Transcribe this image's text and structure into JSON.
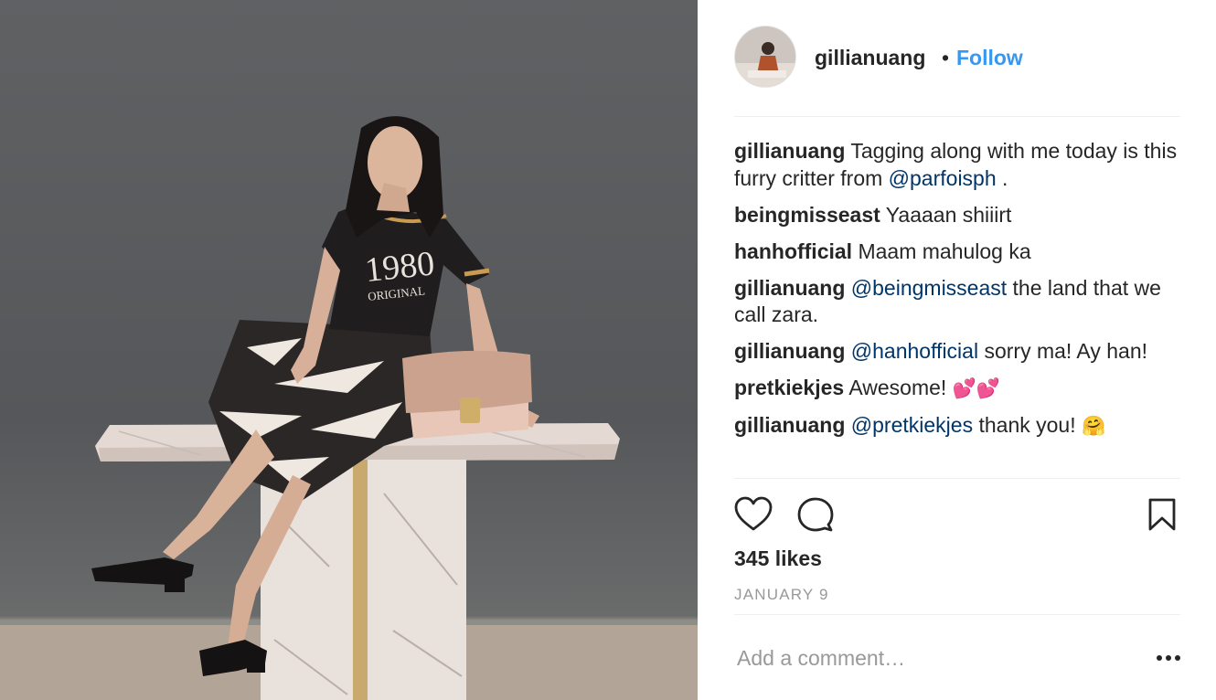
{
  "post": {
    "username": "gillianuang",
    "separator": "•",
    "follow_label": "Follow"
  },
  "comments": [
    {
      "user": "gillianuang",
      "text_before": "Tagging along with me today is this furry critter from ",
      "mention": "@parfoisph",
      "text_after": " ."
    },
    {
      "user": "beingmisseast",
      "text_before": "Yaaaan shiiirt",
      "mention": "",
      "text_after": ""
    },
    {
      "user": "hanhofficial",
      "text_before": "Maam mahulog ka",
      "mention": "",
      "text_after": ""
    },
    {
      "user": "gillianuang",
      "text_before": "",
      "mention": "@beingmisseast",
      "text_after": " the land that we call zara."
    },
    {
      "user": "gillianuang",
      "text_before": "",
      "mention": "@hanhofficial",
      "text_after": " sorry ma! Ay han!"
    },
    {
      "user": "pretkiekjes",
      "text_before": "Awesome! ",
      "mention": "",
      "text_after": "",
      "emoji": "💕💕"
    },
    {
      "user": "gillianuang",
      "text_before": "",
      "mention": "@pretkiekjes",
      "text_after": " thank you! ",
      "emoji": "🤗"
    }
  ],
  "actions": {
    "like_icon": "heart-outline-icon",
    "comment_icon": "speech-bubble-icon",
    "save_icon": "bookmark-outline-icon"
  },
  "likes_text": "345 likes",
  "date_text": "JANUARY 9",
  "add_comment_placeholder": "Add a comment…",
  "more_icon": "ellipsis-icon",
  "photo": {
    "tshirt_print_line1": "1980",
    "tshirt_print_line2": "ORIGINAL"
  },
  "colors": {
    "link_blue": "#3897f0",
    "mention_blue": "#003569",
    "text": "#262626",
    "muted": "#999999",
    "separator": "#efefef"
  }
}
